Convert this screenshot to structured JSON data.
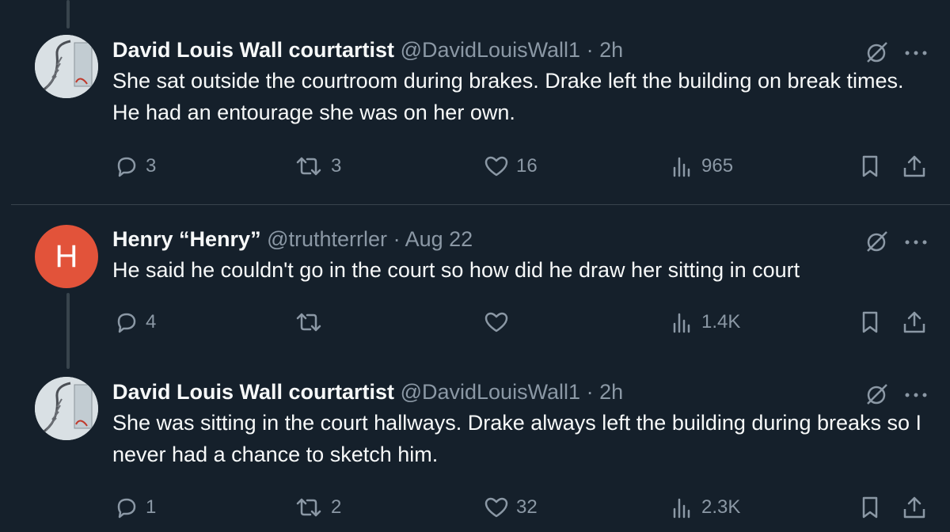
{
  "tweets": [
    {
      "name": "David Louis Wall courtartist",
      "handle": "@DavidLouisWall1",
      "dot": "·",
      "time": "2h",
      "text": "She sat outside the courtroom during brakes. Drake left the building on break times. He had an entourage she was on her own.",
      "avatar_icon": "sketch-staircase-photo",
      "stats": {
        "replies": "3",
        "reposts": "3",
        "likes": "16",
        "views": "965"
      }
    },
    {
      "name": "Henry “Henry”",
      "handle": "@truthterrler",
      "dot": "·",
      "time": "Aug 22",
      "text": "He said he couldn't go in the court so how did he draw her sitting in court",
      "avatar_letter": "H",
      "avatar_color": "#e2533a",
      "stats": {
        "replies": "4",
        "reposts": "",
        "likes": "",
        "views": "1.4K"
      }
    },
    {
      "name": "David Louis Wall courtartist",
      "handle": "@DavidLouisWall1",
      "dot": "·",
      "time": "2h",
      "text": "She was sitting in the court hallways. Drake always left the building during breaks so I never had a chance to sketch him.",
      "avatar_icon": "sketch-staircase-photo",
      "stats": {
        "replies": "1",
        "reposts": "2",
        "likes": "32",
        "views": "2.3K"
      }
    }
  ],
  "colors": {
    "background": "#15202b",
    "muted": "#8b98a5",
    "text": "#f7f9f9",
    "line": "#38444d"
  },
  "icons": [
    "reply-icon",
    "repost-icon",
    "like-icon",
    "views-icon",
    "bookmark-icon",
    "share-icon",
    "grok-icon",
    "more-icon"
  ]
}
